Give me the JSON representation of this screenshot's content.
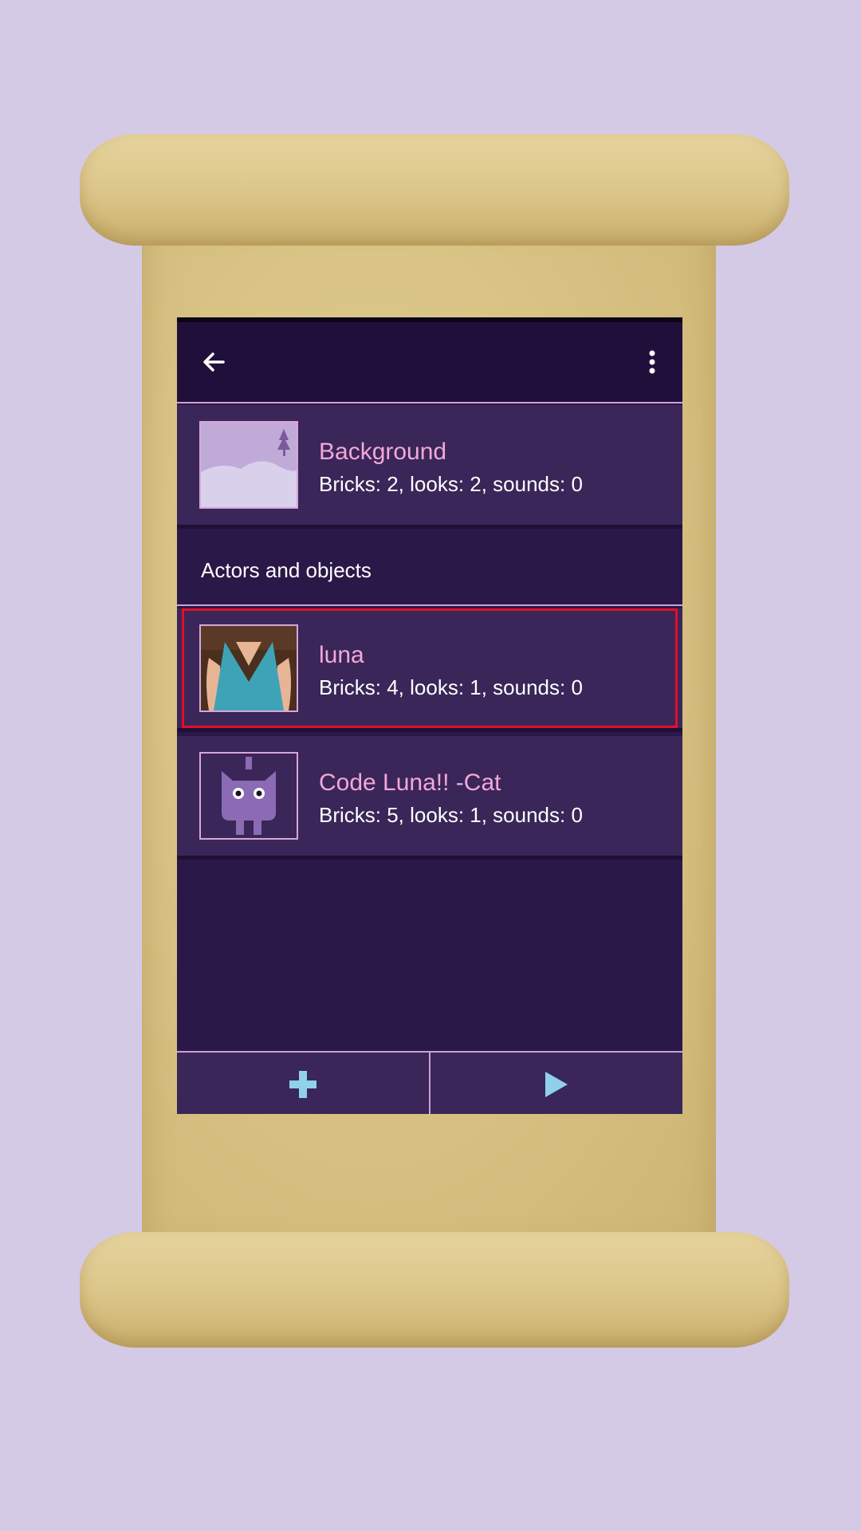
{
  "app_bar": {
    "back_icon": "arrow-left-icon",
    "menu_icon": "more-vertical-icon"
  },
  "background_item": {
    "name": "Background",
    "details": "Bricks: 2, looks: 2, sounds: 0",
    "thumb_icon": "background-thumbnail"
  },
  "section": {
    "title": "Actors and objects"
  },
  "actors": [
    {
      "name": "luna",
      "details": "Bricks: 4, looks: 1, sounds: 0",
      "thumb_icon": "luna-thumbnail",
      "selected": true
    },
    {
      "name": "Code Luna!! -Cat",
      "details": "Bricks: 5, looks: 1, sounds: 0",
      "thumb_icon": "cat-thumbnail",
      "selected": false
    }
  ],
  "bottom_bar": {
    "add_icon": "plus-icon",
    "play_icon": "play-icon"
  },
  "colors": {
    "page_bg": "#d4cae6",
    "app_bg": "#2a1848",
    "app_bar": "#210f3b",
    "row_bg": "#3a2658",
    "name_text": "#f3a8d8",
    "accent_icon": "#8fd0ea",
    "highlight": "#e0102a"
  }
}
